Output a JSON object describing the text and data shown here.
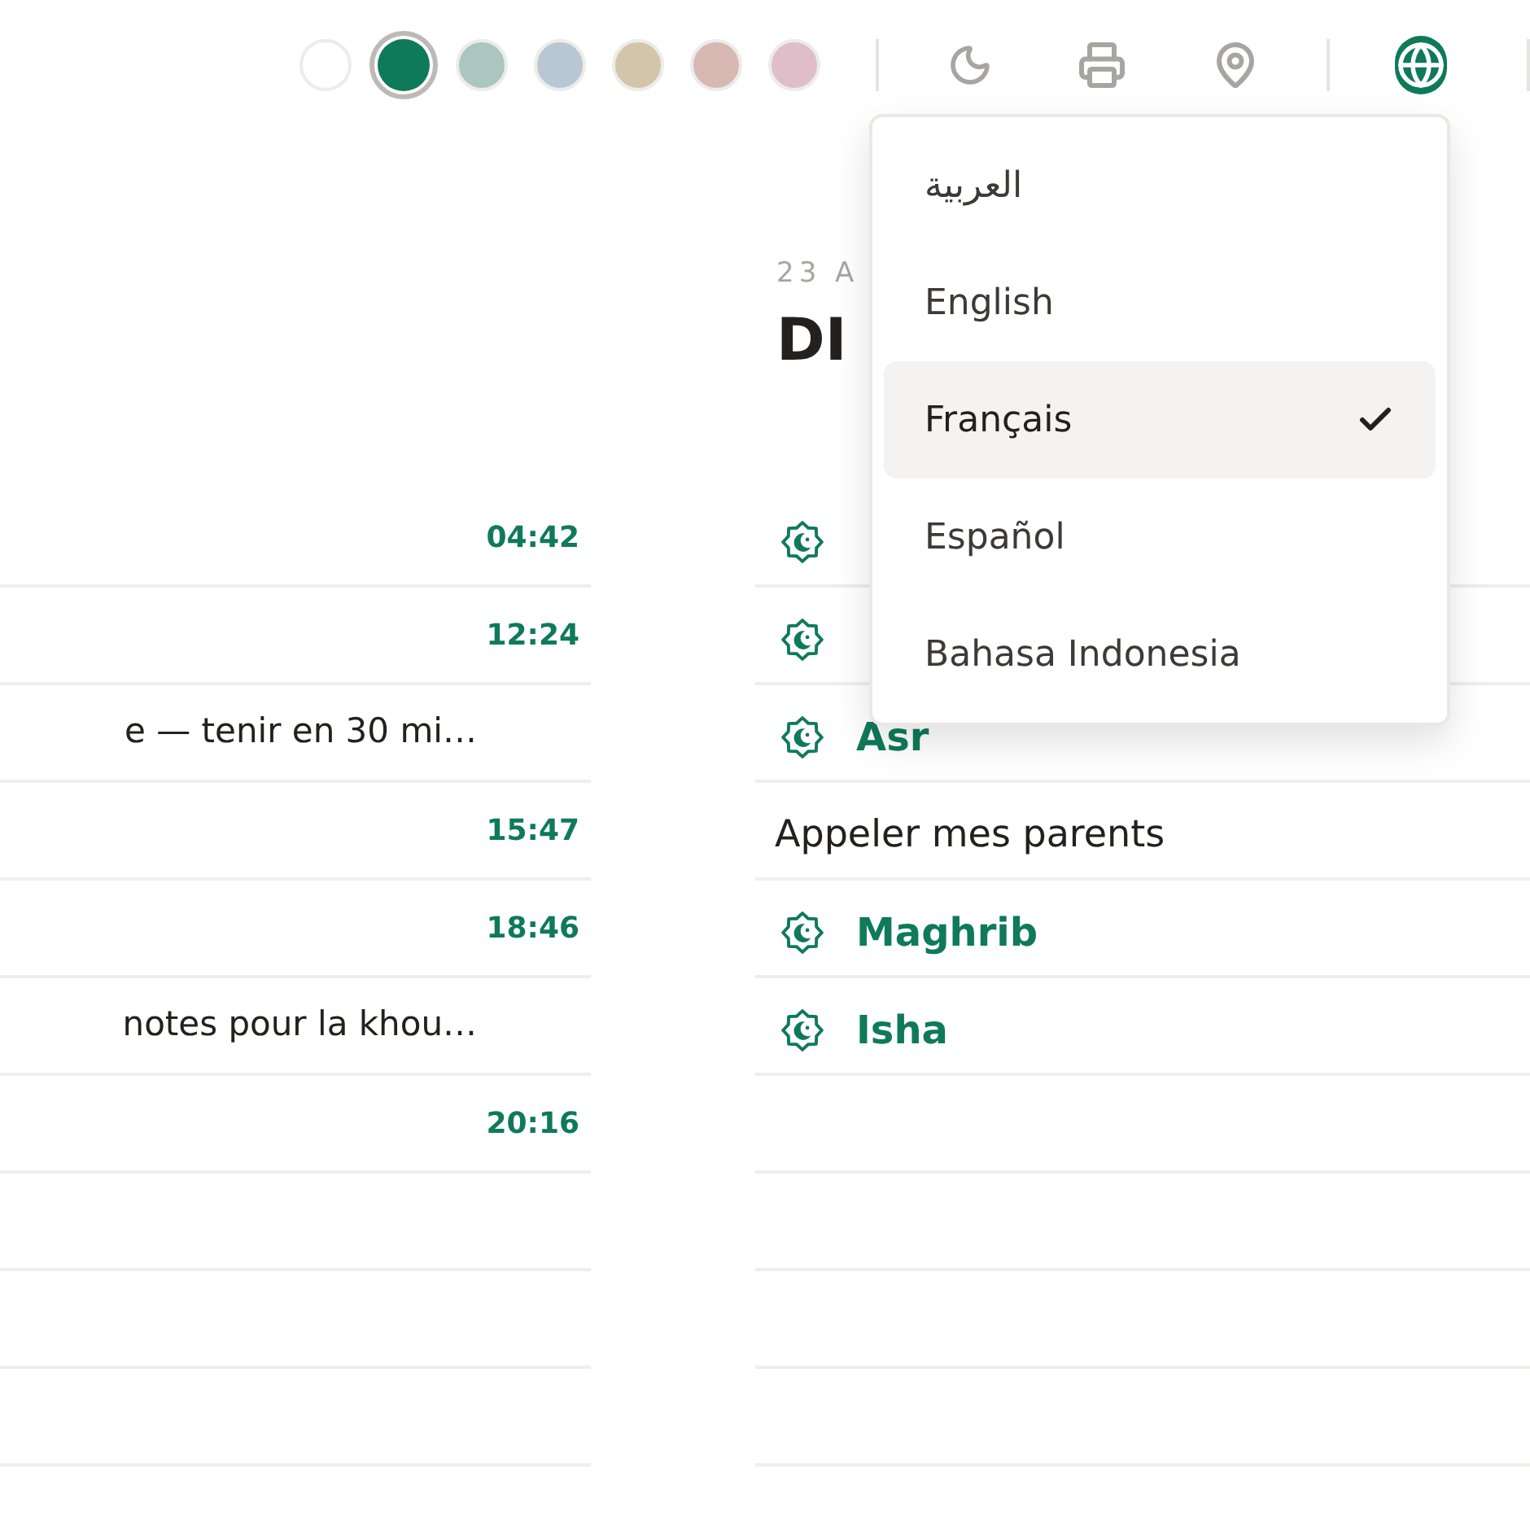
{
  "palette": [
    {
      "color": "#ffffff",
      "selected": false
    },
    {
      "color": "#0f7a5a",
      "selected": true
    },
    {
      "color": "#abc6c0",
      "selected": false
    },
    {
      "color": "#b9c7d3",
      "selected": false
    },
    {
      "color": "#d3c5ab",
      "selected": false
    },
    {
      "color": "#d8b8b3",
      "selected": false
    },
    {
      "color": "#e0bec9",
      "selected": false
    }
  ],
  "left_column": {
    "rows": [
      {
        "kind": "time",
        "text": "04:42"
      },
      {
        "kind": "time",
        "text": "12:24"
      },
      {
        "kind": "task",
        "text": "e — tenir en 30 mi…"
      },
      {
        "kind": "time",
        "text": "15:47"
      },
      {
        "kind": "time",
        "text": "18:46"
      },
      {
        "kind": "task",
        "text": "notes pour la khou…"
      },
      {
        "kind": "time",
        "text": "20:16"
      },
      {
        "kind": "empty"
      },
      {
        "kind": "empty"
      },
      {
        "kind": "empty"
      }
    ]
  },
  "right_column": {
    "date": "23 A",
    "title": "DI",
    "rows": [
      {
        "kind": "prayer"
      },
      {
        "kind": "prayer"
      },
      {
        "kind": "prayer",
        "text": "Asr"
      },
      {
        "kind": "task",
        "text": "Appeler mes parents"
      },
      {
        "kind": "prayer",
        "text": "Maghrib"
      },
      {
        "kind": "prayer",
        "text": "Isha"
      },
      {
        "kind": "empty"
      },
      {
        "kind": "empty"
      },
      {
        "kind": "empty"
      },
      {
        "kind": "empty"
      }
    ]
  },
  "language_menu": {
    "items": [
      {
        "label": "العربية",
        "selected": false
      },
      {
        "label": "English",
        "selected": false
      },
      {
        "label": "Français",
        "selected": true
      },
      {
        "label": "Español",
        "selected": false
      },
      {
        "label": "Bahasa Indonesia",
        "selected": false
      }
    ]
  }
}
